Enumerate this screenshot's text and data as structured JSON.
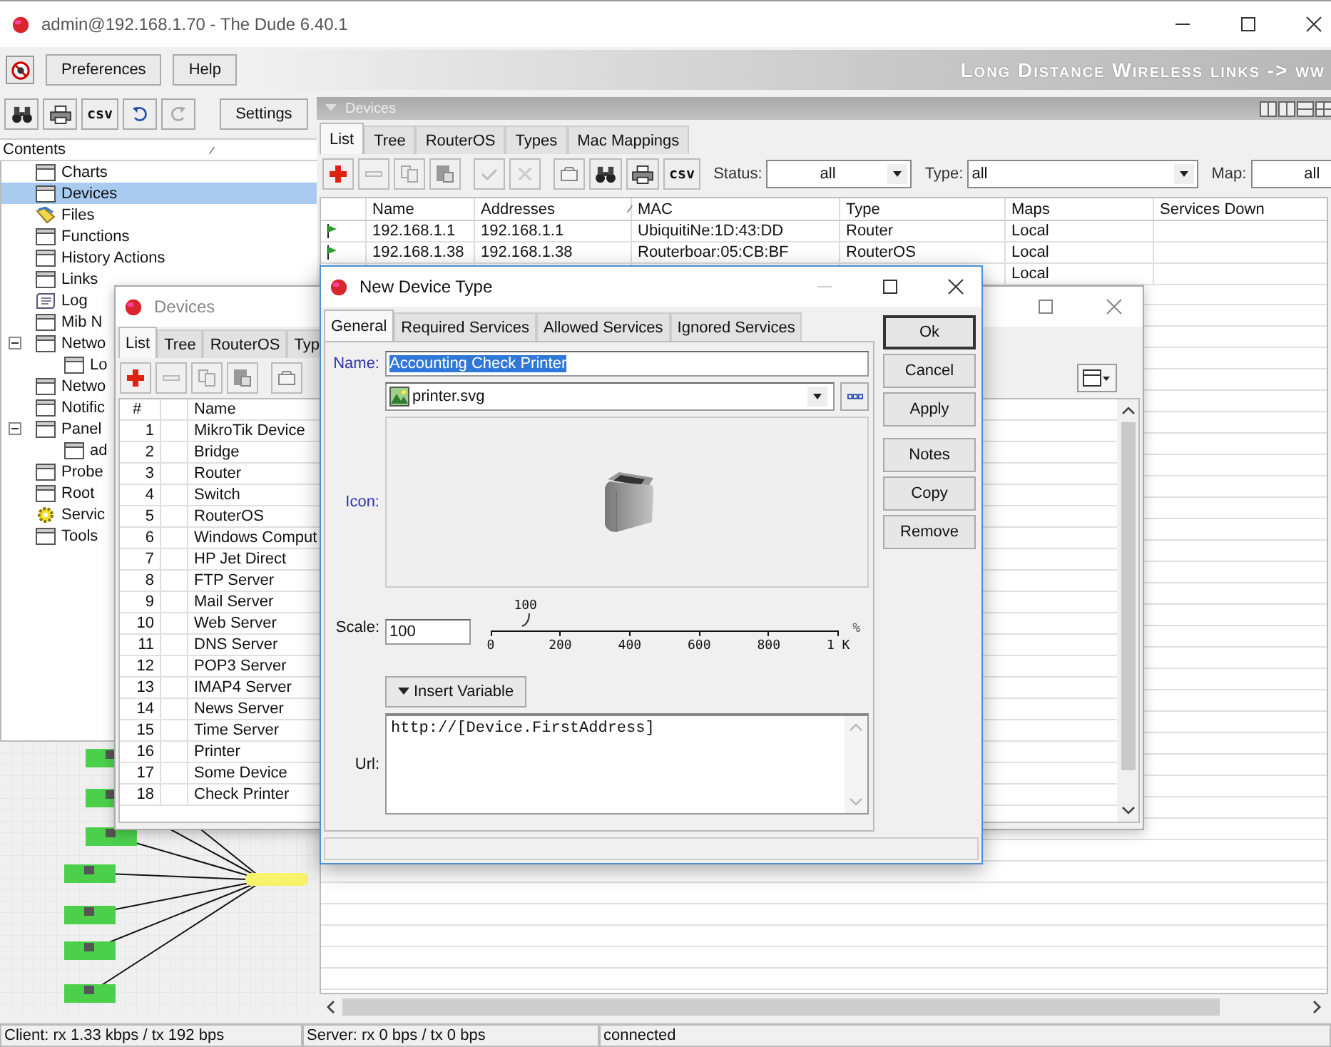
{
  "window": {
    "title": "admin@192.168.1.70 - The Dude 6.40.1"
  },
  "menu": [
    "Preferences",
    "Help"
  ],
  "banner": "Long Distance Wireless links -> ww",
  "left_toolbar": {
    "csv": "csv",
    "settings": "Settings"
  },
  "contents": {
    "header": "Contents",
    "items": [
      {
        "label": "Charts",
        "kind": "table",
        "selected": false
      },
      {
        "label": "Devices",
        "kind": "table",
        "selected": true
      },
      {
        "label": "Files",
        "kind": "files",
        "selected": false
      },
      {
        "label": "Functions",
        "kind": "table",
        "selected": false
      },
      {
        "label": "History Actions",
        "kind": "table",
        "selected": false
      },
      {
        "label": "Links",
        "kind": "table",
        "selected": false
      },
      {
        "label": "Log",
        "kind": "log",
        "selected": false
      },
      {
        "label": "Mib N",
        "kind": "table",
        "selected": false
      },
      {
        "label": "Netwo",
        "kind": "table",
        "selected": false,
        "expanded": true,
        "children": [
          {
            "label": "Lo",
            "kind": "table",
            "selected": false
          }
        ]
      },
      {
        "label": "Netwo",
        "kind": "table",
        "selected": false
      },
      {
        "label": "Notific",
        "kind": "table",
        "selected": false
      },
      {
        "label": "Panel",
        "kind": "table",
        "selected": false,
        "expanded": true,
        "children": [
          {
            "label": "ad",
            "kind": "table",
            "selected": false
          }
        ]
      },
      {
        "label": "Probe",
        "kind": "table",
        "selected": false
      },
      {
        "label": "Root",
        "kind": "table",
        "selected": false
      },
      {
        "label": "Servic",
        "kind": "gear",
        "selected": false
      },
      {
        "label": "Tools",
        "kind": "table",
        "selected": false
      }
    ]
  },
  "devices_panel": {
    "title": "Devices",
    "tabs": [
      {
        "label": "List",
        "selected": true
      },
      {
        "label": "Tree",
        "selected": false
      },
      {
        "label": "RouterOS",
        "selected": false
      },
      {
        "label": "Types",
        "selected": false
      },
      {
        "label": "Mac Mappings",
        "selected": false
      }
    ],
    "csv": "csv",
    "filters": [
      {
        "label": "Status:",
        "value": "all"
      },
      {
        "label": "Type:",
        "value": "all"
      },
      {
        "label": "Map:",
        "value": "all"
      }
    ],
    "columns": [
      "Name",
      "Addresses",
      "MAC",
      "Type",
      "Maps",
      "Services Down"
    ],
    "rows": [
      {
        "name": "192.168.1.1",
        "addresses": "192.168.1.1",
        "mac": "UbiquitiNe:1D:43:DD",
        "type": "Router",
        "maps": "Local"
      },
      {
        "name": "192.168.1.38",
        "addresses": "192.168.1.38",
        "mac": "Routerboar:05:CB:BF",
        "type": "RouterOS",
        "maps": "Local"
      },
      {
        "maps": "Local"
      }
    ]
  },
  "types_window": {
    "title": "Devices",
    "tabs": [
      {
        "label": "List",
        "selected": true
      },
      {
        "label": "Tree",
        "selected": false
      },
      {
        "label": "RouterOS",
        "selected": false
      },
      {
        "label": "Typ",
        "selected": false
      }
    ],
    "columns": [
      "#",
      "Name"
    ],
    "rows": [
      {
        "num": "1",
        "name": "MikroTik Device"
      },
      {
        "num": "2",
        "name": "Bridge"
      },
      {
        "num": "3",
        "name": "Router"
      },
      {
        "num": "4",
        "name": "Switch"
      },
      {
        "num": "5",
        "name": "RouterOS"
      },
      {
        "num": "6",
        "name": "Windows Comput"
      },
      {
        "num": "7",
        "name": "HP Jet Direct"
      },
      {
        "num": "8",
        "name": "FTP Server"
      },
      {
        "num": "9",
        "name": "Mail Server"
      },
      {
        "num": "10",
        "name": "Web Server"
      },
      {
        "num": "11",
        "name": "DNS Server"
      },
      {
        "num": "12",
        "name": "POP3 Server"
      },
      {
        "num": "13",
        "name": "IMAP4 Server"
      },
      {
        "num": "14",
        "name": "News Server"
      },
      {
        "num": "15",
        "name": "Time Server"
      },
      {
        "num": "16",
        "name": "Printer"
      },
      {
        "num": "17",
        "name": "Some Device"
      },
      {
        "num": "18",
        "name": "Check Printer"
      }
    ]
  },
  "dialog": {
    "title": "New Device Type",
    "tabs": [
      {
        "label": "General",
        "selected": true
      },
      {
        "label": "Required Services",
        "selected": false
      },
      {
        "label": "Allowed Services",
        "selected": false
      },
      {
        "label": "Ignored Services",
        "selected": false
      }
    ],
    "button_groups": [
      [
        {
          "label": "Ok",
          "default": true
        },
        {
          "label": "Cancel",
          "default": false
        },
        {
          "label": "Apply",
          "default": false
        }
      ],
      [
        {
          "label": "Notes",
          "default": false
        },
        {
          "label": "Copy",
          "default": false
        },
        {
          "label": "Remove",
          "default": false
        }
      ]
    ],
    "name_label": "Name:",
    "name_value": "Accounting Check Printer",
    "name_text_selected": true,
    "icon_file": "printer.svg",
    "icon_label": "Icon:",
    "scale_label": "Scale:",
    "scale_value": "100",
    "scale_slider": {
      "level": 0.1,
      "thumb_label": "100",
      "ticks": [
        "0",
        "200",
        "400",
        "600",
        "800",
        "1 K"
      ],
      "unit": "%"
    },
    "insert_button": "Insert Variable",
    "url_label": "Url:",
    "url_value": "http://[Device.FirstAddress]"
  },
  "status_bar": [
    "Client: rx 1.33 kbps / tx 192 bps",
    "Server: rx 0 bps / tx 0 bps",
    "connected"
  ]
}
